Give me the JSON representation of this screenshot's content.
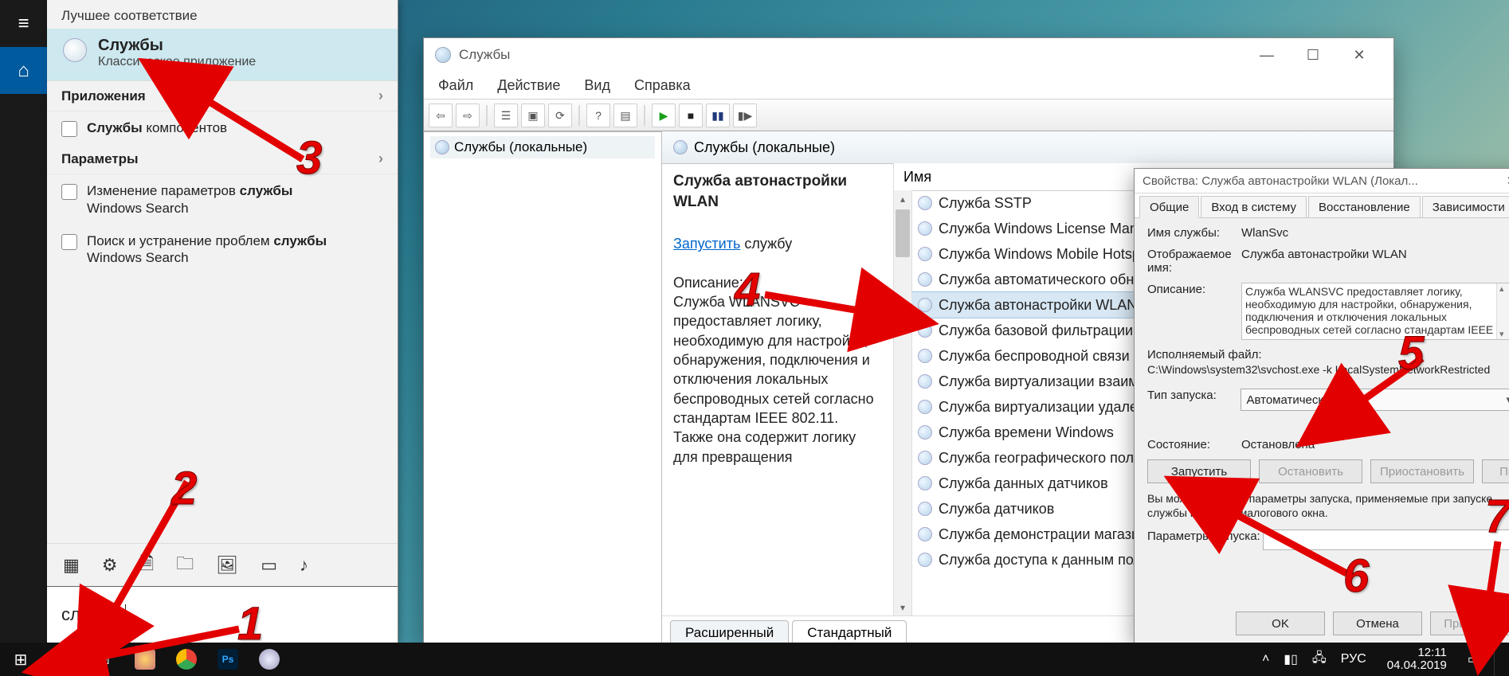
{
  "start": {
    "best_match_header": "Лучшее соответствие",
    "best_title": "Службы",
    "best_subtitle": "Классическое приложение",
    "apps_header": "Приложения",
    "apps_item_prefix": "Службы",
    "apps_item_suffix": " компонентов",
    "settings_header": "Параметры",
    "setting1_prefix": "Изменение параметров ",
    "setting1_bold": "службы",
    "setting1_line2": "Windows Search",
    "setting2_prefix": "Поиск и устранение проблем ",
    "setting2_bold": "службы",
    "setting2_line2": "Windows Search",
    "search_text": "службы"
  },
  "services": {
    "title": "Службы",
    "menu": {
      "file": "Файл",
      "action": "Действие",
      "view": "Вид",
      "help": "Справка"
    },
    "tree_node": "Службы (локальные)",
    "right_head": "Службы (локальные)",
    "detail": {
      "heading": "Служба автонастройки WLAN",
      "start_link": "Запустить",
      "start_suffix": " службу",
      "desc_label": "Описание:",
      "desc": "Служба WLANSVC предоставляет логику, необходимую для настройки, обнаружения, подключения и отключения локальных беспроводных сетей согласно стандартам IEEE 802.11. Также она содержит логику для превращения"
    },
    "col_name": "Имя",
    "list": [
      "Служба SSTP",
      "Служба Windows License Manag",
      "Служба Windows Mobile Hotspo",
      "Служба автоматического обнар",
      "Служба автонастройки WLAN",
      "Служба базовой фильтрации",
      "Служба беспроводной связи Blu",
      "Служба виртуализации взаимод",
      "Служба виртуализации удаленн",
      "Служба времени Windows",
      "Служба географического полож",
      "Служба данных датчиков",
      "Служба датчиков",
      "Служба демонстрации магазина",
      "Служба доступа к данным поль"
    ],
    "tab_extended": "Расширенный",
    "tab_standard": "Стандартный"
  },
  "props": {
    "title": "Свойства: Служба автонастройки WLAN (Локал...",
    "tabs": {
      "general": "Общие",
      "logon": "Вход в систему",
      "recovery": "Восстановление",
      "deps": "Зависимости"
    },
    "name_label": "Имя службы:",
    "name_value": "WlanSvc",
    "disp_label1": "Отображаемое",
    "disp_label2": "имя:",
    "disp_value": "Служба автонастройки WLAN",
    "desc_label": "Описание:",
    "desc_value": "Служба WLANSVC предоставляет логику, необходимую для настройки, обнаружения, подключения и отключения локальных беспроводных сетей согласно стандартам IEEE",
    "exe_label": "Исполняемый файл:",
    "exe_value": "C:\\Windows\\system32\\svchost.exe -k LocalSystemNetworkRestricted",
    "start_type_label": "Тип запуска:",
    "start_type_value": "Автоматически",
    "state_label": "Состояние:",
    "state_value": "Остановлена",
    "btn_start": "Запустить",
    "btn_stop": "Остановить",
    "btn_pause": "Приостановить",
    "btn_resume": "Продолжить",
    "note": "Вы можете указать параметры запуска, применяемые при запуске службы из этого диалогового окна.",
    "params_label": "Параметры запуска:",
    "ok": "OK",
    "cancel": "Отмена",
    "apply": "Применить"
  },
  "taskbar": {
    "lang": "РУС",
    "time": "12:11",
    "date": "04.04.2019"
  },
  "annotations": {
    "1": "1",
    "2": "2",
    "3": "3",
    "4": "4",
    "5": "5",
    "6": "6",
    "7": "7"
  }
}
